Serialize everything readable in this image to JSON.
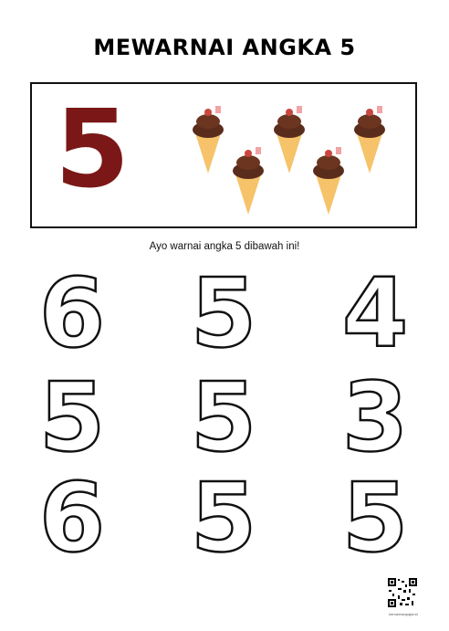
{
  "worksheet": {
    "title": "MEWARNAI ANGKA 5",
    "example_number": "5",
    "example_color": "#7b1717",
    "example_items": "ice-cream-cone",
    "example_count": 5,
    "instruction": "Ayo warnai angka 5 dibawah ini!"
  },
  "grid": {
    "digits": [
      "6",
      "5",
      "4",
      "5",
      "5",
      "3",
      "6",
      "5",
      "5"
    ]
  },
  "footer": {
    "site": "kenuemanpajar.id"
  }
}
